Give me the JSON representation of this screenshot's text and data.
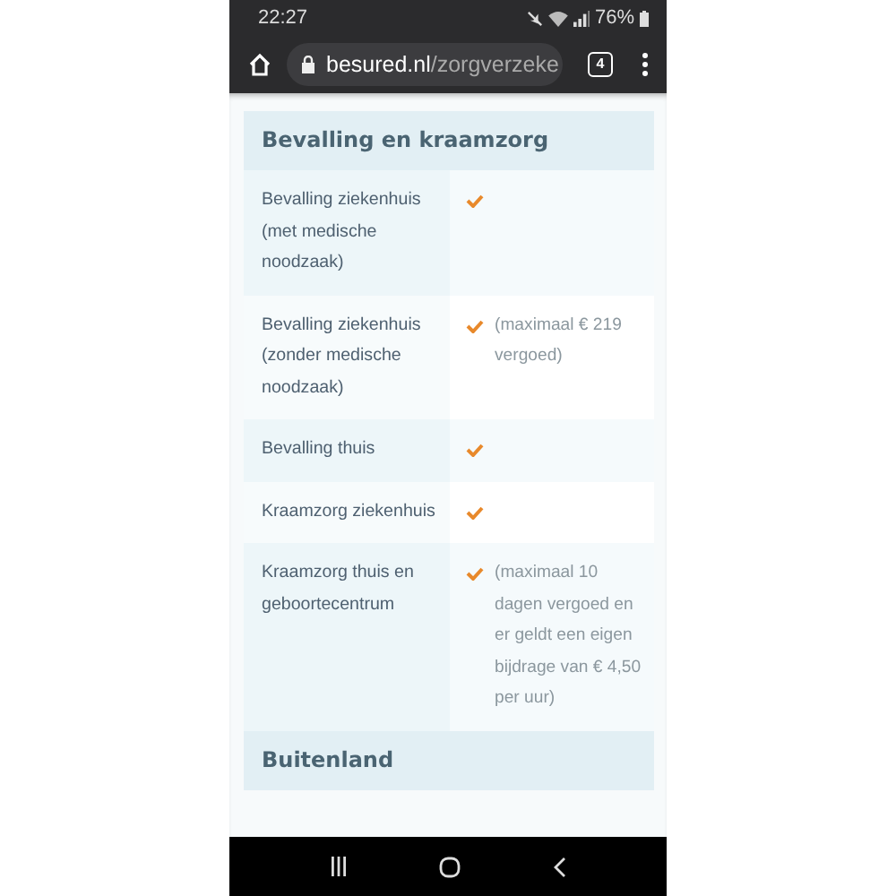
{
  "status_bar": {
    "time": "22:27",
    "battery": "76%"
  },
  "browser": {
    "url_domain": "besured.nl",
    "url_path": "/zorgverzeke",
    "tab_count": "4"
  },
  "sections": [
    {
      "title": "Bevalling en kraamzorg",
      "rows": [
        {
          "label": "Bevalling ziekenhuis (met medische noodzaak)",
          "covered": true
        },
        {
          "label": "Bevalling ziekenhuis (zonder medische noodzaak)",
          "covered": true,
          "note": "(maximaal € 219 vergoed)"
        },
        {
          "label": "Bevalling thuis",
          "covered": true
        },
        {
          "label": "Kraamzorg ziekenhuis",
          "covered": true
        },
        {
          "label": "Kraamzorg thuis en geboortecentrum",
          "covered": true,
          "note": "(maximaal 10 dagen vergoed en er geldt een eigen bijdrage van € 4,50 per uur)"
        }
      ]
    },
    {
      "title": "Buitenland"
    }
  ]
}
